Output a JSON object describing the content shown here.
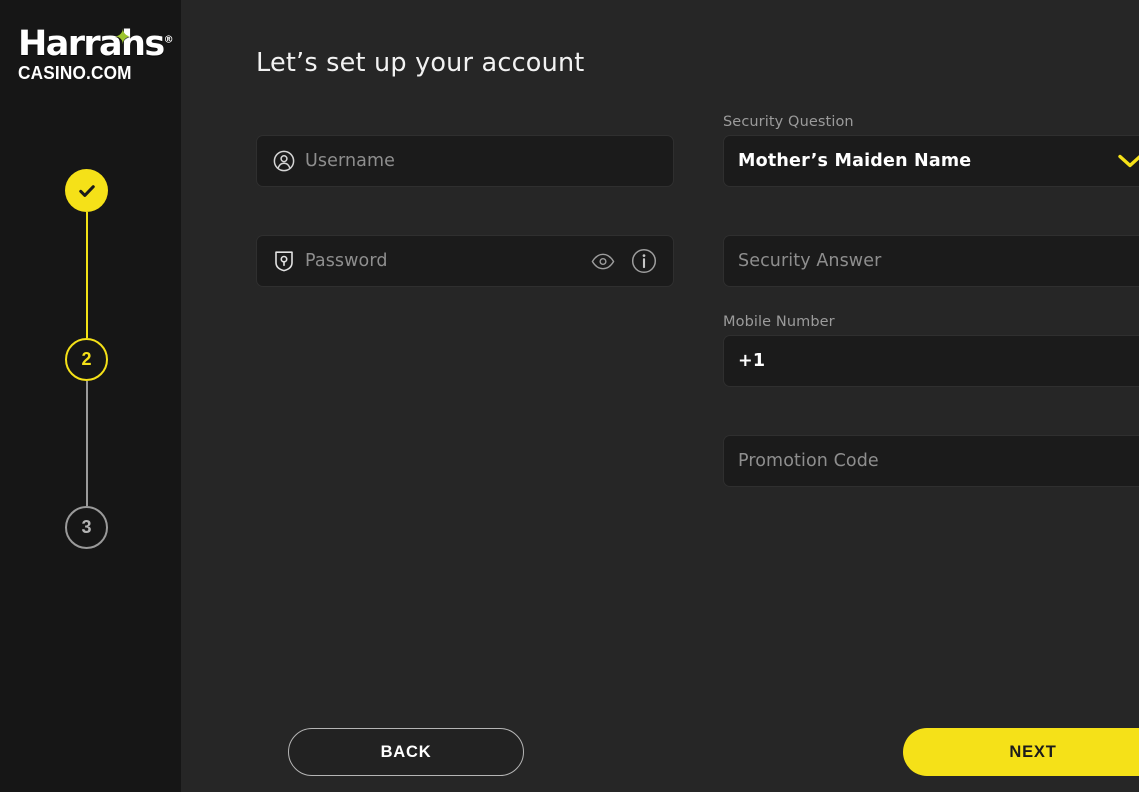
{
  "brand": {
    "logo_main": "Harrah",
    "logo_main_tail": "s",
    "logo_star": "star-icon",
    "logo_registered": "®",
    "logo_sub": "CASINO.COM"
  },
  "stepper": {
    "steps": [
      {
        "id": "step-1",
        "label": "",
        "state": "complete",
        "icon": "check-icon"
      },
      {
        "id": "step-2",
        "label": "2",
        "state": "current",
        "icon": ""
      },
      {
        "id": "step-3",
        "label": "3",
        "state": "upcoming",
        "icon": ""
      }
    ]
  },
  "main": {
    "title": "Let’s set up your account",
    "left_fields": [
      {
        "name": "username",
        "icon": "user-circle-icon",
        "placeholder": "Username",
        "value": ""
      },
      {
        "name": "password",
        "icon": "shield-key-icon",
        "placeholder": "Password",
        "value": "",
        "trailing_icons": [
          "eye-icon",
          "info-icon"
        ]
      }
    ],
    "right_fields": [
      {
        "name": "security-question",
        "label": "Security Question",
        "value": "Mother’s Maiden Name",
        "placeholder": "",
        "trailing_icon": "chevron-down-icon"
      },
      {
        "name": "security-answer",
        "label": "",
        "value": "",
        "placeholder": "Security Answer"
      },
      {
        "name": "mobile-number",
        "label": "Mobile Number",
        "value": "+1",
        "placeholder": ""
      },
      {
        "name": "promotion-code",
        "label": "",
        "value": "",
        "placeholder": "Promotion Code"
      }
    ]
  },
  "footer": {
    "back_label": "BACK",
    "next_label": "NEXT"
  },
  "colors": {
    "accent_yellow": "#f5e118",
    "sidebar_bg": "#161616",
    "main_bg": "#262626",
    "field_bg": "#1b1b1b",
    "logo_star_green": "#9ec52e",
    "muted_text": "#8e8e8e"
  }
}
